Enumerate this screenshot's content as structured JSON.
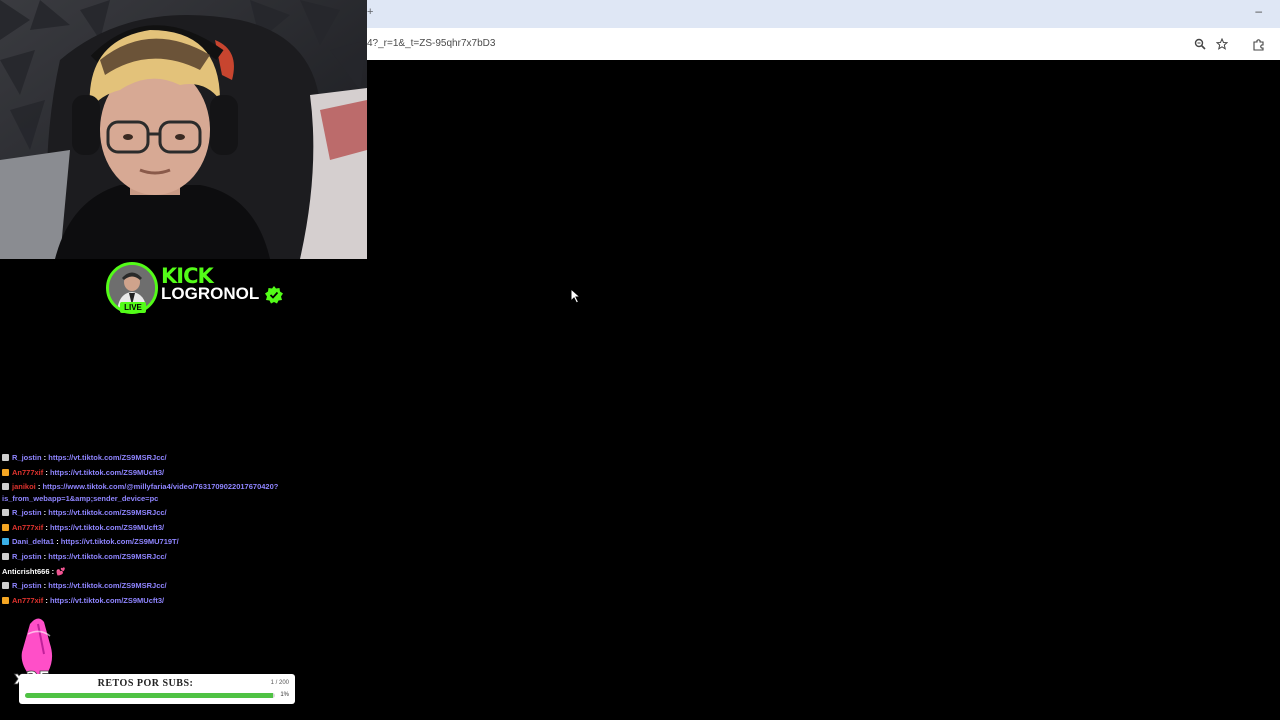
{
  "browser": {
    "tab_plus": "+",
    "minimize": "–",
    "url": "4?_r=1&_t=ZS-95qhr7x7bD3"
  },
  "overlay": {
    "kick_logo": "KICK",
    "channel_name": "LOGRONOL",
    "live_label": "LIVE",
    "accent_color": "#53fc18"
  },
  "chat": {
    "messages": [
      {
        "user": "R_jostin",
        "color": "#8f85ff",
        "badge": "#cfcfcf",
        "text": "https://vt.tiktok.com/ZS9MSRJcc/"
      },
      {
        "user": "An777xif",
        "color": "#e0332e",
        "badge": "#f5a623",
        "text": "https://vt.tiktok.com/ZS9MUcft3/"
      },
      {
        "user": "janikoi",
        "color": "#e0332e",
        "badge": "#cfcfcf",
        "text": "https://www.tiktok.com/@millyfaria4/video/7631709022017670420?is_from_webapp=1&amp;sender_device=pc"
      },
      {
        "user": "R_jostin",
        "color": "#8f85ff",
        "badge": "#cfcfcf",
        "text": "https://vt.tiktok.com/ZS9MSRJcc/"
      },
      {
        "user": "An777xif",
        "color": "#e0332e",
        "badge": "#f5a623",
        "text": "https://vt.tiktok.com/ZS9MUcft3/"
      },
      {
        "user": "Dani_delta1",
        "color": "#8f85ff",
        "badge": "#3ab0e8",
        "text": "https://vt.tiktok.com/ZS9MU719T/"
      },
      {
        "user": "R_jostin",
        "color": "#8f85ff",
        "badge": "#cfcfcf",
        "text": "https://vt.tiktok.com/ZS9MSRJcc/"
      },
      {
        "user": "Anticrisht666",
        "color": "#ffffff",
        "badge": "",
        "text": "💕"
      },
      {
        "user": "R_jostin",
        "color": "#8f85ff",
        "badge": "#cfcfcf",
        "text": "https://vt.tiktok.com/ZS9MSRJcc/"
      },
      {
        "user": "An777xif",
        "color": "#e0332e",
        "badge": "#f5a623",
        "text": "https://vt.tiktok.com/ZS9MUcft3/"
      }
    ]
  },
  "goal": {
    "title": "RETOS POR SUBS:",
    "count": "1 / 200",
    "percent_label": "1%",
    "progress": 0.99
  },
  "sticker": {
    "label": "x25"
  }
}
